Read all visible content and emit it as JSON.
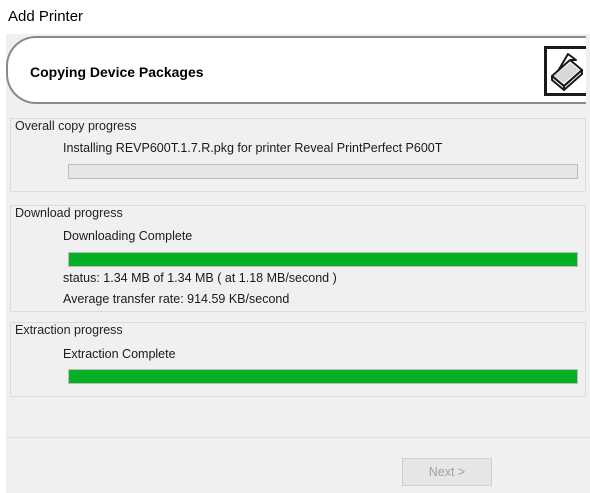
{
  "window": {
    "title": "Add Printer"
  },
  "banner": {
    "title": "Copying Device Packages",
    "icon": "printer-icon"
  },
  "overall": {
    "label": "Overall copy progress",
    "status": "Installing REVP600T.1.7.R.pkg for printer Reveal PrintPerfect P600T",
    "progress": 0
  },
  "download": {
    "label": "Download progress",
    "status": "Downloading Complete",
    "progress": 100,
    "detail": "status: 1.34 MB of 1.34 MB ( at 1.18 MB/second )",
    "rate": "Average transfer rate: 914.59 KB/second"
  },
  "extraction": {
    "label": "Extraction progress",
    "status": "Extraction Complete",
    "progress": 100
  },
  "buttons": {
    "next_label": "Next >"
  },
  "colors": {
    "progress_fill": "#06b025"
  }
}
